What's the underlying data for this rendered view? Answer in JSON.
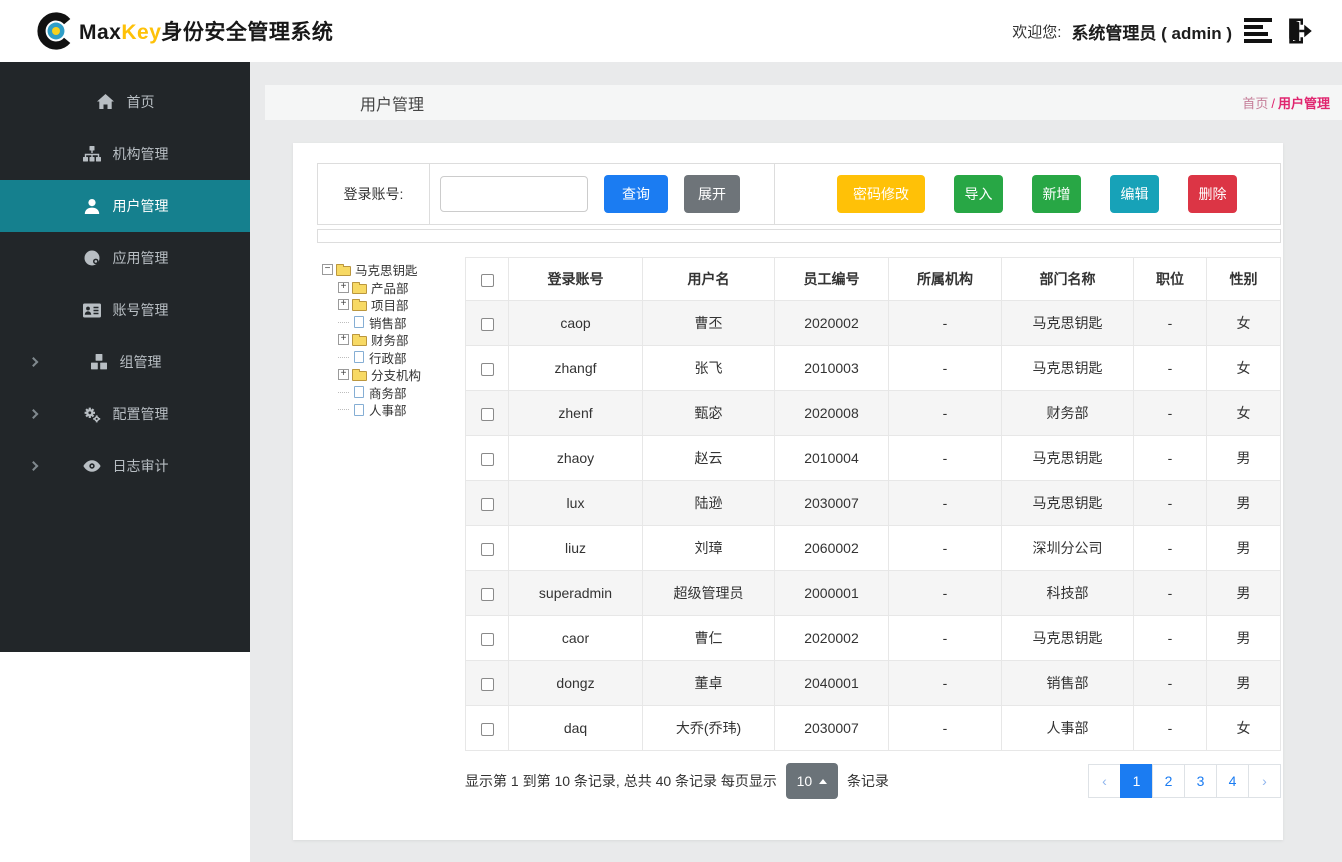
{
  "header": {
    "brand": {
      "max": "Max",
      "key": "Key",
      "suffix": "身份安全管理系统"
    },
    "welcome_label": "欢迎您:",
    "user_display": "系统管理员 ( admin )",
    "icons": [
      "menu-bars-icon",
      "logout-icon"
    ]
  },
  "colors": {
    "primary_blue": "#1b7cf2",
    "warning_yellow": "#ffc107",
    "success_green": "#28a745",
    "info_teal": "#17a2b8",
    "danger_red": "#dc3545",
    "secondary_gray": "#6e7479",
    "sidebar_bg": "#222629",
    "sidebar_active": "#15808e",
    "breadcrumb_pink": "#e0256f",
    "brand_yellow": "#fec108"
  },
  "sidebar": {
    "items": [
      {
        "label": "首页",
        "icon": "home-icon",
        "active": false,
        "has_submenu": false
      },
      {
        "label": "机构管理",
        "icon": "sitemap-icon",
        "active": false,
        "has_submenu": false
      },
      {
        "label": "用户管理",
        "icon": "user-icon",
        "active": true,
        "has_submenu": false
      },
      {
        "label": "应用管理",
        "icon": "app-icon",
        "active": false,
        "has_submenu": false
      },
      {
        "label": "账号管理",
        "icon": "id-card-icon",
        "active": false,
        "has_submenu": false
      },
      {
        "label": "组管理",
        "icon": "cubes-icon",
        "active": false,
        "has_submenu": true
      },
      {
        "label": "配置管理",
        "icon": "gears-icon",
        "active": false,
        "has_submenu": true
      },
      {
        "label": "日志审计",
        "icon": "eye-icon",
        "active": false,
        "has_submenu": true
      }
    ]
  },
  "page": {
    "title": "用户管理",
    "breadcrumb": {
      "home": "首页",
      "separator": "/",
      "current": "用户管理"
    }
  },
  "search": {
    "label": "登录账号:",
    "input_value": "",
    "query_label": "查询",
    "expand_label": "展开"
  },
  "actions": [
    {
      "label": "密码修改",
      "color": "#ffc107"
    },
    {
      "label": "导入",
      "color": "#28a745"
    },
    {
      "label": "新增",
      "color": "#28a745"
    },
    {
      "label": "编辑",
      "color": "#17a2b8"
    },
    {
      "label": "删除",
      "color": "#dc3545"
    }
  ],
  "tree": {
    "nodes": [
      {
        "label": "马克思钥匙",
        "level": 0,
        "icon": "folder-open",
        "expander": "minus"
      },
      {
        "label": "产品部",
        "level": 1,
        "icon": "folder",
        "expander": "plus"
      },
      {
        "label": "项目部",
        "level": 1,
        "icon": "folder",
        "expander": "plus"
      },
      {
        "label": "销售部",
        "level": 1,
        "icon": "file",
        "expander": "none"
      },
      {
        "label": "财务部",
        "level": 1,
        "icon": "folder",
        "expander": "plus"
      },
      {
        "label": "行政部",
        "level": 1,
        "icon": "file",
        "expander": "none"
      },
      {
        "label": "分支机构",
        "level": 1,
        "icon": "folder",
        "expander": "plus"
      },
      {
        "label": "商务部",
        "level": 1,
        "icon": "file",
        "expander": "none"
      },
      {
        "label": "人事部",
        "level": 1,
        "icon": "file",
        "expander": "none"
      }
    ]
  },
  "table": {
    "columns": [
      "登录账号",
      "用户名",
      "员工编号",
      "所属机构",
      "部门名称",
      "职位",
      "性别"
    ],
    "rows": [
      [
        "caop",
        "曹丕",
        "2020002",
        "-",
        "马克思钥匙",
        "-",
        "女"
      ],
      [
        "zhangf",
        "张飞",
        "2010003",
        "-",
        "马克思钥匙",
        "-",
        "女"
      ],
      [
        "zhenf",
        "甄宓",
        "2020008",
        "-",
        "财务部",
        "-",
        "女"
      ],
      [
        "zhaoy",
        "赵云",
        "2010004",
        "-",
        "马克思钥匙",
        "-",
        "男"
      ],
      [
        "lux",
        "陆逊",
        "2030007",
        "-",
        "马克思钥匙",
        "-",
        "男"
      ],
      [
        "liuz",
        "刘璋",
        "2060002",
        "-",
        "深圳分公司",
        "-",
        "男"
      ],
      [
        "superadmin",
        "超级管理员",
        "2000001",
        "-",
        "科技部",
        "-",
        "男"
      ],
      [
        "caor",
        "曹仁",
        "2020002",
        "-",
        "马克思钥匙",
        "-",
        "男"
      ],
      [
        "dongz",
        "董卓",
        "2040001",
        "-",
        "销售部",
        "-",
        "男"
      ],
      [
        "daq",
        "大乔(乔玮)",
        "2030007",
        "-",
        "人事部",
        "-",
        "女"
      ]
    ]
  },
  "footer": {
    "info_before": "显示第 1 到第 10 条记录, 总共 40 条记录 每页显示",
    "page_size": "10",
    "info_after": "条记录",
    "pagination": {
      "prev": "‹",
      "pages": [
        "1",
        "2",
        "3",
        "4"
      ],
      "next": "›",
      "active": "1"
    }
  }
}
